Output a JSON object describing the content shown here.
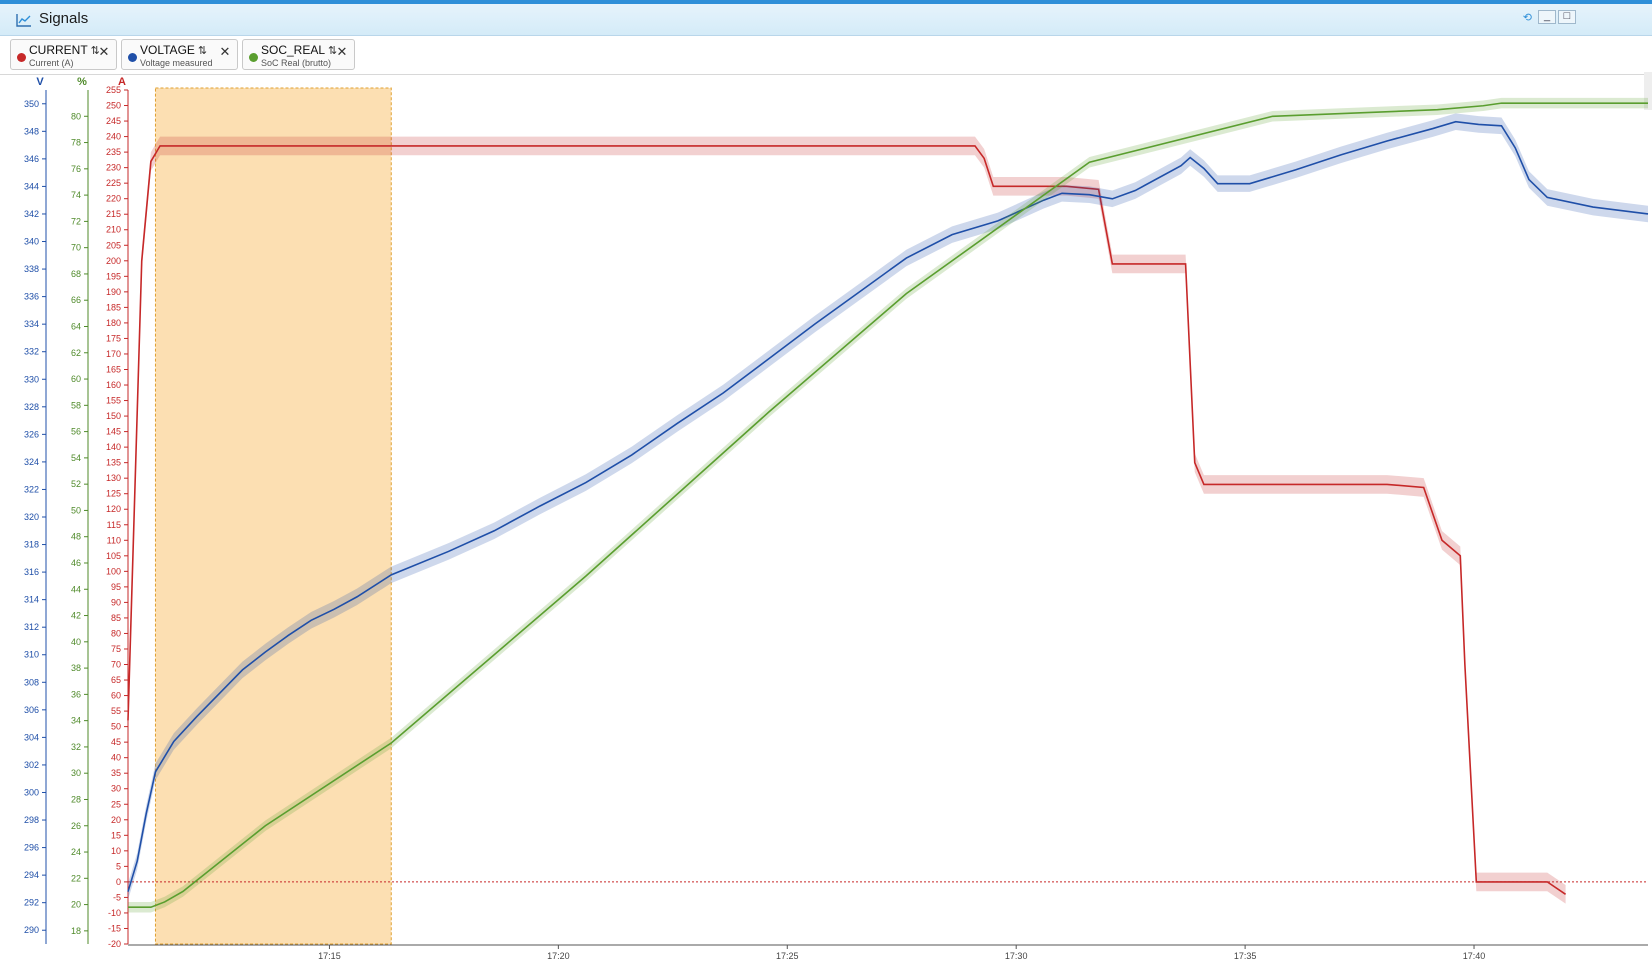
{
  "window": {
    "title": "Signals",
    "title_icon": "line-chart-icon",
    "controls": [
      "refresh-icon",
      "minimize-icon",
      "maximize-icon"
    ]
  },
  "signals": [
    {
      "name": "CURRENT",
      "sort_glyph": "⇅",
      "description": "Current (A)",
      "color": "#c62828"
    },
    {
      "name": "VOLTAGE",
      "sort_glyph": "⇅",
      "description": "Voltage measured",
      "color": "#1f4fa8"
    },
    {
      "name": "SOC_REAL",
      "sort_glyph": "⇅",
      "description": "SoC Real (brutto)",
      "color": "#5a9e2f"
    }
  ],
  "chart_data": {
    "type": "line",
    "x_ticks": [
      "17:15",
      "17:20",
      "17:25",
      "17:30",
      "17:35",
      "17:40"
    ],
    "x_range_minutes": [
      0,
      30
    ],
    "highlight_region": {
      "x_from": 0.6,
      "x_to": 5.75,
      "color": "#fcd9a4"
    },
    "zero_reference": {
      "axis": "A",
      "value": 0,
      "color": "#c62828",
      "style": "dotted"
    },
    "axes": [
      {
        "unit": "V",
        "color": "#1f4fa8",
        "min": 289,
        "max": 351,
        "ticks": [
          290,
          292,
          294,
          296,
          298,
          300,
          302,
          304,
          306,
          308,
          310,
          312,
          314,
          316,
          318,
          320,
          322,
          324,
          326,
          328,
          330,
          332,
          334,
          336,
          338,
          340,
          342,
          344,
          346,
          348,
          350
        ]
      },
      {
        "unit": "%",
        "color": "#4f8a2a",
        "min": 17,
        "max": 82,
        "ticks": [
          18,
          20,
          22,
          24,
          26,
          28,
          30,
          32,
          34,
          36,
          38,
          40,
          42,
          44,
          46,
          48,
          50,
          52,
          54,
          56,
          58,
          60,
          62,
          64,
          66,
          68,
          70,
          72,
          74,
          76,
          78,
          80
        ]
      },
      {
        "unit": "A",
        "color": "#c62828",
        "min": -20,
        "max": 255,
        "ticks": [
          -20,
          -15,
          -10,
          -5,
          0,
          5,
          10,
          15,
          20,
          25,
          30,
          35,
          40,
          45,
          50,
          55,
          60,
          65,
          70,
          75,
          80,
          85,
          90,
          95,
          100,
          105,
          110,
          115,
          120,
          125,
          130,
          135,
          140,
          145,
          150,
          155,
          160,
          165,
          170,
          175,
          180,
          185,
          190,
          195,
          200,
          205,
          210,
          215,
          220,
          225,
          230,
          235,
          240,
          245,
          250,
          255
        ]
      }
    ],
    "series": [
      {
        "name": "CURRENT",
        "axis": "A",
        "color": "#c62828",
        "points": [
          [
            0,
            52
          ],
          [
            0.3,
            200
          ],
          [
            0.5,
            232
          ],
          [
            0.7,
            237
          ],
          [
            1.5,
            237
          ],
          [
            5,
            237
          ],
          [
            10,
            237
          ],
          [
            15,
            237
          ],
          [
            18.5,
            237
          ],
          [
            18.7,
            233
          ],
          [
            18.9,
            224
          ],
          [
            19.5,
            224
          ],
          [
            20.5,
            224
          ],
          [
            21.2,
            223
          ],
          [
            21.5,
            199
          ],
          [
            21.8,
            199
          ],
          [
            22.5,
            199
          ],
          [
            23.1,
            199
          ],
          [
            23.3,
            135
          ],
          [
            23.5,
            128
          ],
          [
            24.5,
            128
          ],
          [
            26,
            128
          ],
          [
            27.5,
            128
          ],
          [
            28.3,
            127
          ],
          [
            28.7,
            110
          ],
          [
            29.1,
            105
          ],
          [
            29.2,
            70
          ],
          [
            29.45,
            0
          ],
          [
            30,
            0
          ],
          [
            31,
            0
          ],
          [
            31.4,
            -4
          ]
        ],
        "band": 3
      },
      {
        "name": "VOLTAGE",
        "axis": "V",
        "color": "#1f4fa8",
        "points": [
          [
            0,
            292.8
          ],
          [
            0.2,
            295
          ],
          [
            0.4,
            298.5
          ],
          [
            0.6,
            301.5
          ],
          [
            1,
            303.7
          ],
          [
            1.5,
            305.5
          ],
          [
            2,
            307.2
          ],
          [
            2.5,
            308.9
          ],
          [
            3,
            310.2
          ],
          [
            3.5,
            311.4
          ],
          [
            4,
            312.5
          ],
          [
            4.5,
            313.3
          ],
          [
            5,
            314.2
          ],
          [
            5.75,
            315.8
          ],
          [
            7,
            317.5
          ],
          [
            8,
            319
          ],
          [
            9,
            320.8
          ],
          [
            10,
            322.5
          ],
          [
            11,
            324.5
          ],
          [
            12,
            326.8
          ],
          [
            13,
            329
          ],
          [
            14,
            331.5
          ],
          [
            15,
            334
          ],
          [
            16,
            336.4
          ],
          [
            17,
            338.8
          ],
          [
            18,
            340.5
          ],
          [
            19,
            341.5
          ],
          [
            20,
            343
          ],
          [
            20.4,
            343.5
          ],
          [
            21,
            343.4
          ],
          [
            21.5,
            343.1
          ],
          [
            22,
            343.7
          ],
          [
            23,
            345.5
          ],
          [
            23.2,
            346.1
          ],
          [
            23.5,
            345.3
          ],
          [
            23.8,
            344.2
          ],
          [
            24.5,
            344.2
          ],
          [
            25.5,
            345.2
          ],
          [
            26.5,
            346.3
          ],
          [
            27.5,
            347.3
          ],
          [
            28.5,
            348.2
          ],
          [
            29,
            348.7
          ],
          [
            29.5,
            348.5
          ],
          [
            30,
            348.4
          ],
          [
            30.3,
            346.8
          ],
          [
            30.6,
            344.5
          ],
          [
            31,
            343.2
          ],
          [
            32,
            342.5
          ],
          [
            33.2,
            342
          ]
        ],
        "band": 0.6
      },
      {
        "name": "SOC_REAL",
        "axis": "%",
        "color": "#5a9e2f",
        "points": [
          [
            0,
            19.8
          ],
          [
            0.5,
            19.8
          ],
          [
            0.8,
            20.2
          ],
          [
            1.2,
            21
          ],
          [
            3,
            26
          ],
          [
            5.75,
            32.3
          ],
          [
            10,
            45
          ],
          [
            14,
            57.5
          ],
          [
            17,
            66.5
          ],
          [
            21,
            76.5
          ],
          [
            25,
            80
          ],
          [
            28.6,
            80.5
          ],
          [
            29.6,
            80.8
          ],
          [
            30,
            81
          ],
          [
            33.2,
            81
          ]
        ],
        "band": 0.4
      }
    ]
  }
}
